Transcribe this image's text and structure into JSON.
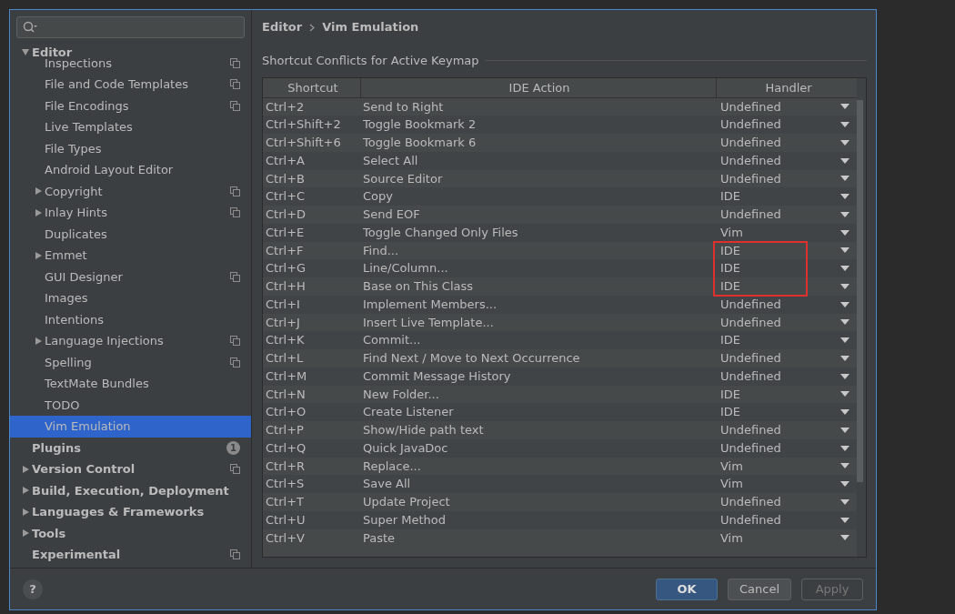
{
  "sidebar": {
    "items": [
      {
        "label": "Editor",
        "expanded": true,
        "children": [
          {
            "label": "Inspections",
            "project_icon": true,
            "selected": false
          },
          {
            "label": "File and Code Templates",
            "project_icon": true,
            "selected": false
          },
          {
            "label": "File Encodings",
            "project_icon": true,
            "selected": false
          },
          {
            "label": "Live Templates",
            "project_icon": false,
            "selected": false
          },
          {
            "label": "File Types",
            "project_icon": false,
            "selected": false
          },
          {
            "label": "Android Layout Editor",
            "project_icon": false,
            "selected": false
          },
          {
            "label": "Copyright",
            "project_icon": true,
            "selected": false,
            "expanded": false
          },
          {
            "label": "Inlay Hints",
            "project_icon": true,
            "selected": false,
            "expanded": false
          },
          {
            "label": "Duplicates",
            "project_icon": false,
            "selected": false
          },
          {
            "label": "Emmet",
            "project_icon": false,
            "selected": false,
            "expanded": false
          },
          {
            "label": "GUI Designer",
            "project_icon": true,
            "selected": false
          },
          {
            "label": "Images",
            "project_icon": false,
            "selected": false
          },
          {
            "label": "Intentions",
            "project_icon": false,
            "selected": false
          },
          {
            "label": "Language Injections",
            "project_icon": true,
            "selected": false,
            "expanded": false
          },
          {
            "label": "Spelling",
            "project_icon": true,
            "selected": false
          },
          {
            "label": "TextMate Bundles",
            "project_icon": false,
            "selected": false
          },
          {
            "label": "TODO",
            "project_icon": false,
            "selected": false
          },
          {
            "label": "Vim Emulation",
            "project_icon": false,
            "selected": true
          }
        ]
      },
      {
        "label": "Plugins",
        "badge": "1",
        "project_icon": false
      },
      {
        "label": "Version Control",
        "project_icon": true,
        "expanded": false
      },
      {
        "label": "Build, Execution, Deployment",
        "project_icon": false,
        "expanded": false
      },
      {
        "label": "Languages & Frameworks",
        "project_icon": false,
        "expanded": false
      },
      {
        "label": "Tools",
        "project_icon": false,
        "expanded": false
      },
      {
        "label": "Experimental",
        "project_icon": true
      }
    ]
  },
  "breadcrumb": [
    "Editor",
    "Vim Emulation"
  ],
  "section_title": "Shortcut Conflicts for Active Keymap",
  "table": {
    "columns": [
      "Shortcut",
      "IDE Action",
      "Handler"
    ],
    "rows": [
      {
        "shortcut": "Ctrl+2",
        "action": "Send to Right",
        "handler": "Undefined",
        "highlighted": false
      },
      {
        "shortcut": "Ctrl+Shift+2",
        "action": "Toggle Bookmark 2",
        "handler": "Undefined",
        "highlighted": false
      },
      {
        "shortcut": "Ctrl+Shift+6",
        "action": "Toggle Bookmark 6",
        "handler": "Undefined",
        "highlighted": false
      },
      {
        "shortcut": "Ctrl+A",
        "action": "Select All",
        "handler": "Undefined",
        "highlighted": false
      },
      {
        "shortcut": "Ctrl+B",
        "action": "Source Editor",
        "handler": "Undefined",
        "highlighted": false
      },
      {
        "shortcut": "Ctrl+C",
        "action": "Copy",
        "handler": "IDE",
        "highlighted": false
      },
      {
        "shortcut": "Ctrl+D",
        "action": "Send EOF",
        "handler": "Undefined",
        "highlighted": false
      },
      {
        "shortcut": "Ctrl+E",
        "action": "Toggle Changed Only Files",
        "handler": "Vim",
        "highlighted": false
      },
      {
        "shortcut": "Ctrl+F",
        "action": "Find...",
        "handler": "IDE",
        "highlighted": true
      },
      {
        "shortcut": "Ctrl+G",
        "action": "Line/Column...",
        "handler": "IDE",
        "highlighted": true
      },
      {
        "shortcut": "Ctrl+H",
        "action": "Base on This Class",
        "handler": "IDE",
        "highlighted": true
      },
      {
        "shortcut": "Ctrl+I",
        "action": "Implement Members...",
        "handler": "Undefined",
        "highlighted": false
      },
      {
        "shortcut": "Ctrl+J",
        "action": "Insert Live Template...",
        "handler": "Undefined",
        "highlighted": false
      },
      {
        "shortcut": "Ctrl+K",
        "action": "Commit...",
        "handler": "IDE",
        "highlighted": false
      },
      {
        "shortcut": "Ctrl+L",
        "action": "Find Next / Move to Next Occurrence",
        "handler": "Undefined",
        "highlighted": false
      },
      {
        "shortcut": "Ctrl+M",
        "action": "Commit Message History",
        "handler": "Undefined",
        "highlighted": false
      },
      {
        "shortcut": "Ctrl+N",
        "action": "New Folder...",
        "handler": "IDE",
        "highlighted": false
      },
      {
        "shortcut": "Ctrl+O",
        "action": "Create Listener",
        "handler": "IDE",
        "highlighted": false
      },
      {
        "shortcut": "Ctrl+P",
        "action": "Show/Hide path text",
        "handler": "Undefined",
        "highlighted": false
      },
      {
        "shortcut": "Ctrl+Q",
        "action": "Quick JavaDoc",
        "handler": "Undefined",
        "highlighted": false
      },
      {
        "shortcut": "Ctrl+R",
        "action": "Replace...",
        "handler": "Vim",
        "highlighted": false
      },
      {
        "shortcut": "Ctrl+S",
        "action": "Save All",
        "handler": "Vim",
        "highlighted": false
      },
      {
        "shortcut": "Ctrl+T",
        "action": "Update Project",
        "handler": "Undefined",
        "highlighted": false
      },
      {
        "shortcut": "Ctrl+U",
        "action": "Super Method",
        "handler": "Undefined",
        "highlighted": false
      },
      {
        "shortcut": "Ctrl+V",
        "action": "Paste",
        "handler": "Vim",
        "highlighted": false
      }
    ]
  },
  "help": "?",
  "buttons": [
    {
      "label": "OK",
      "kind": "primary"
    },
    {
      "label": "Cancel",
      "kind": "normal"
    },
    {
      "label": "Apply",
      "kind": "disabled"
    }
  ]
}
